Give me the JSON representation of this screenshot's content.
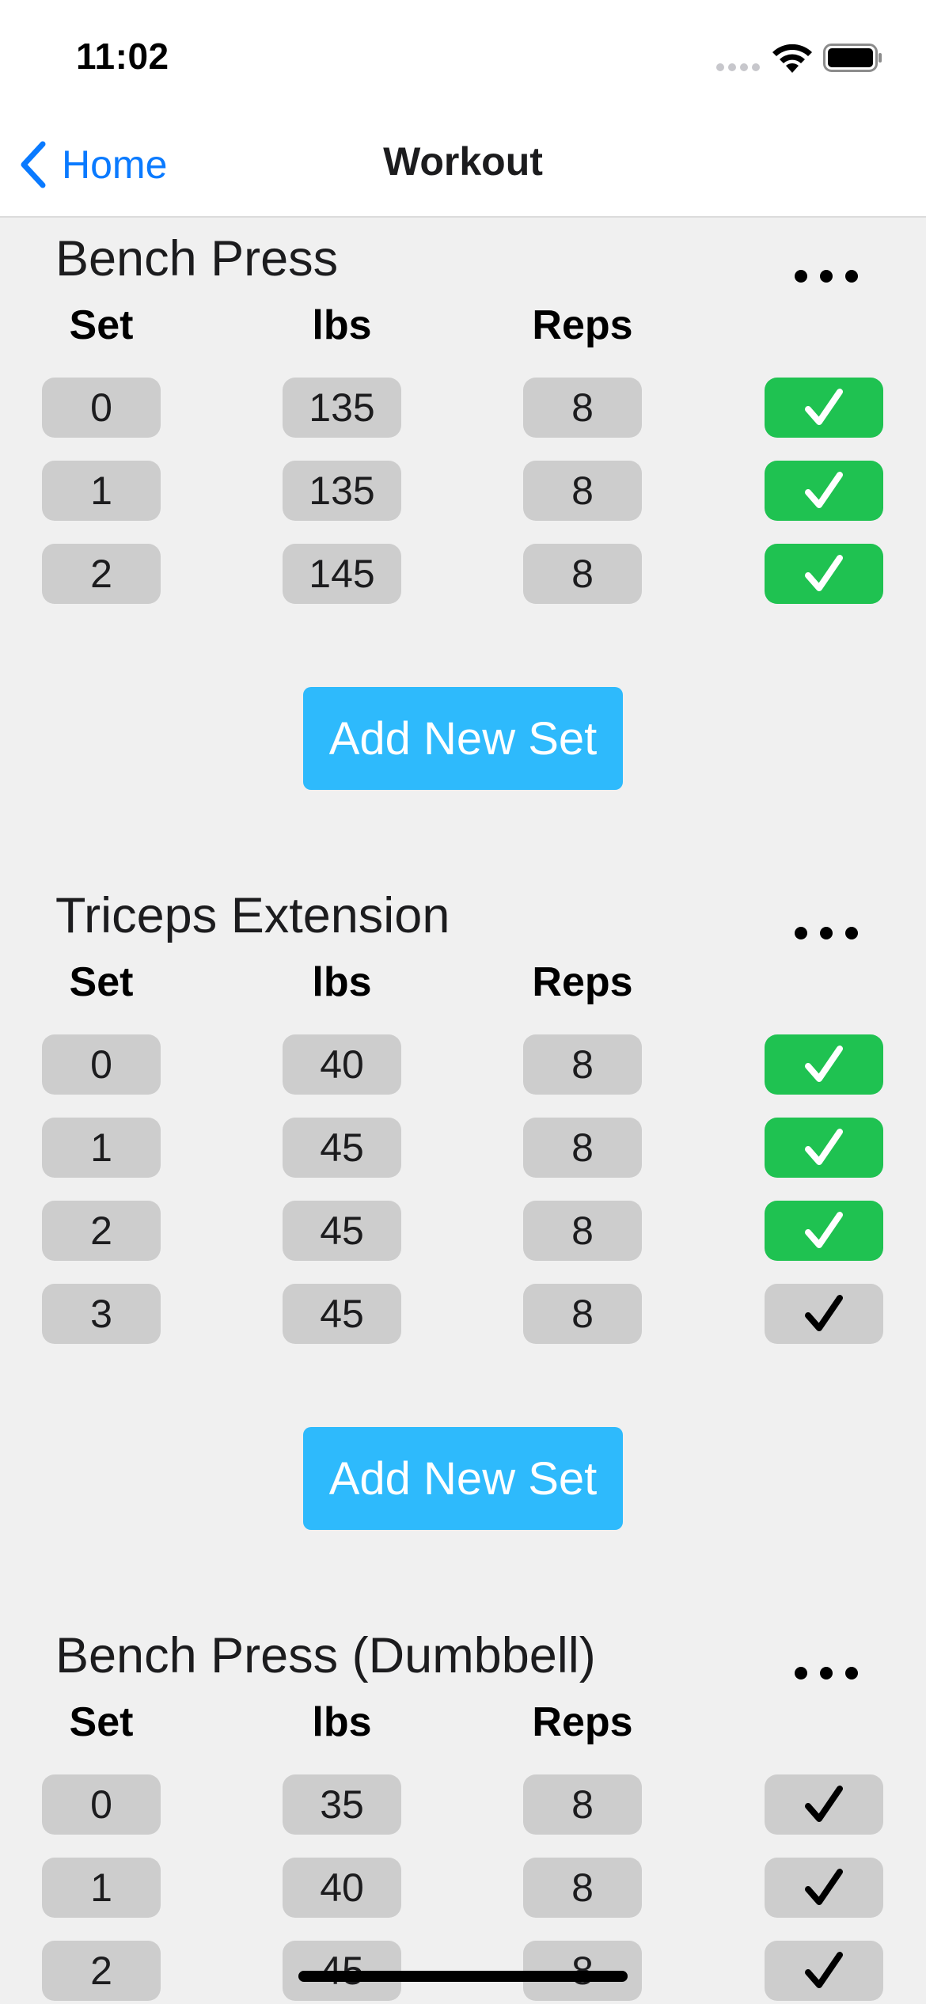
{
  "status_bar": {
    "time": "11:02"
  },
  "nav": {
    "back_label": "Home",
    "title": "Workout"
  },
  "column_headers": {
    "set": "Set",
    "lbs": "lbs",
    "reps": "Reps"
  },
  "add_set_label": "Add New Set",
  "colors": {
    "accent_blue": "#0a7aff",
    "add_button": "#2ebafc",
    "completed_green": "#1fc251",
    "cell_gray": "#cdcdcd",
    "background": "#f0f0f0"
  },
  "icons": {
    "back": "chevron-left-icon",
    "more": "more-horizontal-icon",
    "complete": "checkmark-icon",
    "wifi": "wifi-icon",
    "battery": "battery-icon",
    "signal": "signal-icon"
  },
  "exercises": [
    {
      "name": "Bench Press",
      "sets": [
        {
          "set": "0",
          "lbs": "135",
          "reps": "8",
          "completed": true
        },
        {
          "set": "1",
          "lbs": "135",
          "reps": "8",
          "completed": true
        },
        {
          "set": "2",
          "lbs": "145",
          "reps": "8",
          "completed": true
        }
      ]
    },
    {
      "name": "Triceps Extension",
      "sets": [
        {
          "set": "0",
          "lbs": "40",
          "reps": "8",
          "completed": true
        },
        {
          "set": "1",
          "lbs": "45",
          "reps": "8",
          "completed": true
        },
        {
          "set": "2",
          "lbs": "45",
          "reps": "8",
          "completed": true
        },
        {
          "set": "3",
          "lbs": "45",
          "reps": "8",
          "completed": false
        }
      ]
    },
    {
      "name": "Bench Press (Dumbbell)",
      "sets": [
        {
          "set": "0",
          "lbs": "35",
          "reps": "8",
          "completed": false
        },
        {
          "set": "1",
          "lbs": "40",
          "reps": "8",
          "completed": false
        },
        {
          "set": "2",
          "lbs": "45",
          "reps": "8",
          "completed": false
        }
      ]
    }
  ]
}
